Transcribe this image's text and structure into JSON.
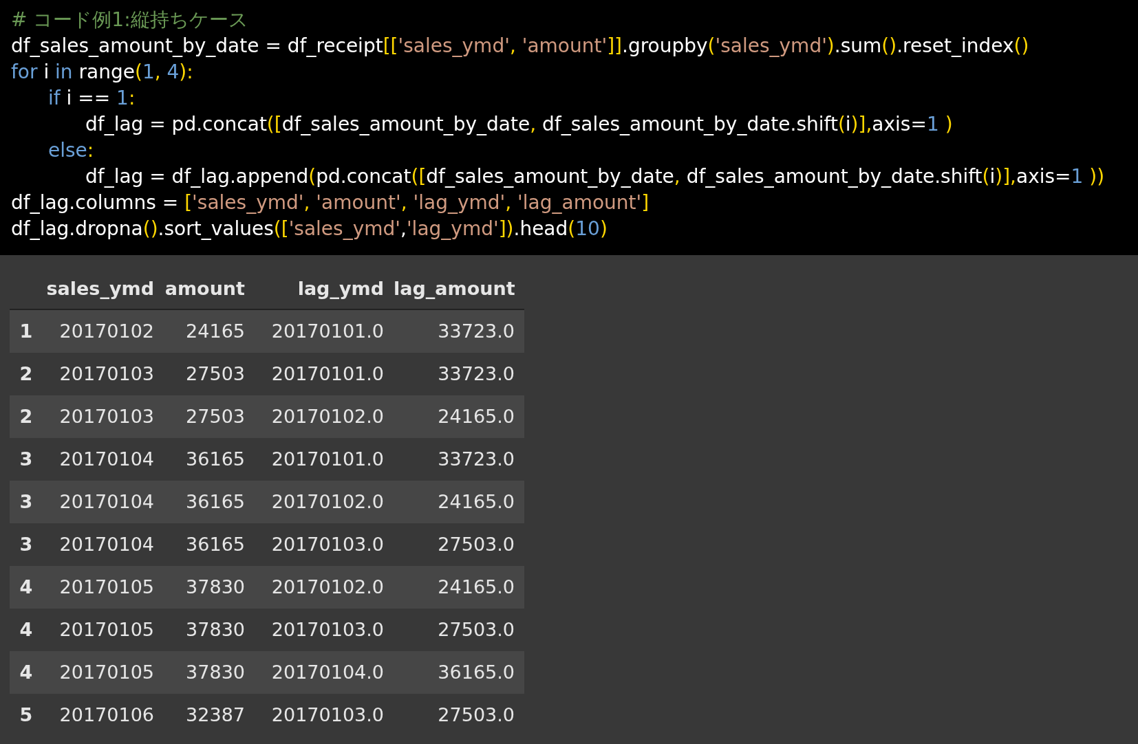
{
  "code": {
    "lines": [
      {
        "tokens": [
          {
            "kind": "comment",
            "text": "# コード例1:縦持ちケース"
          }
        ]
      },
      {
        "tokens": [
          {
            "kind": "text",
            "text": "df_sales_amount_by_date = df_receipt"
          },
          {
            "kind": "paren",
            "text": "[["
          },
          {
            "kind": "string",
            "text": "'sales_ymd'"
          },
          {
            "kind": "paren",
            "text": ", "
          },
          {
            "kind": "string",
            "text": "'amount'"
          },
          {
            "kind": "paren",
            "text": "]]"
          },
          {
            "kind": "text",
            "text": ".groupby"
          },
          {
            "kind": "paren",
            "text": "("
          },
          {
            "kind": "string",
            "text": "'sales_ymd'"
          },
          {
            "kind": "paren",
            "text": ")"
          },
          {
            "kind": "text",
            "text": ".sum"
          },
          {
            "kind": "paren",
            "text": "()"
          },
          {
            "kind": "text",
            "text": ".reset_index"
          },
          {
            "kind": "paren",
            "text": "()"
          }
        ]
      },
      {
        "tokens": [
          {
            "kind": "keyword",
            "text": "for"
          },
          {
            "kind": "text",
            "text": " i "
          },
          {
            "kind": "keyword",
            "text": "in"
          },
          {
            "kind": "text",
            "text": " range"
          },
          {
            "kind": "paren",
            "text": "("
          },
          {
            "kind": "number",
            "text": "1"
          },
          {
            "kind": "paren",
            "text": ", "
          },
          {
            "kind": "number",
            "text": "4"
          },
          {
            "kind": "paren",
            "text": "):"
          }
        ],
        "children": [
          {
            "tokens": [
              {
                "kind": "keyword",
                "text": "if"
              },
              {
                "kind": "text",
                "text": " i == "
              },
              {
                "kind": "number",
                "text": "1"
              },
              {
                "kind": "paren",
                "text": ":"
              }
            ],
            "children": [
              {
                "tokens": [
                  {
                    "kind": "text",
                    "text": "df_lag = pd.concat"
                  },
                  {
                    "kind": "paren",
                    "text": "(["
                  },
                  {
                    "kind": "text",
                    "text": "df_sales_amount_by_date"
                  },
                  {
                    "kind": "paren",
                    "text": ", "
                  },
                  {
                    "kind": "text",
                    "text": "df_sales_amount_by_date.shift"
                  },
                  {
                    "kind": "paren",
                    "text": "("
                  },
                  {
                    "kind": "text",
                    "text": "i"
                  },
                  {
                    "kind": "paren",
                    "text": ")],"
                  },
                  {
                    "kind": "text",
                    "text": "axis="
                  },
                  {
                    "kind": "number",
                    "text": "1"
                  },
                  {
                    "kind": "paren",
                    "text": " )"
                  }
                ]
              }
            ]
          },
          {
            "tokens": [
              {
                "kind": "keyword",
                "text": "else"
              },
              {
                "kind": "paren",
                "text": ":"
              }
            ],
            "children": [
              {
                "tokens": [
                  {
                    "kind": "text",
                    "text": "df_lag = df_lag.append"
                  },
                  {
                    "kind": "paren",
                    "text": "("
                  },
                  {
                    "kind": "text",
                    "text": "pd.concat"
                  },
                  {
                    "kind": "paren",
                    "text": "(["
                  },
                  {
                    "kind": "text",
                    "text": "df_sales_amount_by_date"
                  },
                  {
                    "kind": "paren",
                    "text": ", "
                  },
                  {
                    "kind": "text",
                    "text": "df_sales_amount_by_date.shift"
                  },
                  {
                    "kind": "paren",
                    "text": "("
                  },
                  {
                    "kind": "text",
                    "text": "i"
                  },
                  {
                    "kind": "paren",
                    "text": ")],"
                  },
                  {
                    "kind": "text",
                    "text": "axis="
                  },
                  {
                    "kind": "number",
                    "text": "1"
                  },
                  {
                    "kind": "paren",
                    "text": " ))"
                  }
                ]
              }
            ]
          }
        ]
      },
      {
        "tokens": [
          {
            "kind": "text",
            "text": "df_lag.columns = "
          },
          {
            "kind": "paren",
            "text": "["
          },
          {
            "kind": "string",
            "text": "'sales_ymd'"
          },
          {
            "kind": "paren",
            "text": ", "
          },
          {
            "kind": "string",
            "text": "'amount'"
          },
          {
            "kind": "paren",
            "text": ", "
          },
          {
            "kind": "string",
            "text": "'lag_ymd'"
          },
          {
            "kind": "paren",
            "text": ", "
          },
          {
            "kind": "string",
            "text": "'lag_amount'"
          },
          {
            "kind": "paren",
            "text": "]"
          }
        ]
      },
      {
        "tokens": [
          {
            "kind": "text",
            "text": "df_lag.dropna"
          },
          {
            "kind": "paren",
            "text": "()"
          },
          {
            "kind": "text",
            "text": ".sort_values"
          },
          {
            "kind": "paren",
            "text": "(["
          },
          {
            "kind": "string",
            "text": "'sales_ymd'"
          },
          {
            "kind": "text",
            "text": ","
          },
          {
            "kind": "string",
            "text": "'lag_ymd'"
          },
          {
            "kind": "paren",
            "text": "])"
          },
          {
            "kind": "text",
            "text": ".head"
          },
          {
            "kind": "paren",
            "text": "("
          },
          {
            "kind": "number",
            "text": "10"
          },
          {
            "kind": "paren",
            "text": ")"
          }
        ]
      }
    ]
  },
  "table": {
    "columns": [
      "sales_ymd",
      "amount",
      "lag_ymd",
      "lag_amount"
    ],
    "rows": [
      {
        "index": "1",
        "cells": [
          "20170102",
          "24165",
          "20170101.0",
          "33723.0"
        ]
      },
      {
        "index": "2",
        "cells": [
          "20170103",
          "27503",
          "20170101.0",
          "33723.0"
        ]
      },
      {
        "index": "2",
        "cells": [
          "20170103",
          "27503",
          "20170102.0",
          "24165.0"
        ]
      },
      {
        "index": "3",
        "cells": [
          "20170104",
          "36165",
          "20170101.0",
          "33723.0"
        ]
      },
      {
        "index": "3",
        "cells": [
          "20170104",
          "36165",
          "20170102.0",
          "24165.0"
        ]
      },
      {
        "index": "3",
        "cells": [
          "20170104",
          "36165",
          "20170103.0",
          "27503.0"
        ]
      },
      {
        "index": "4",
        "cells": [
          "20170105",
          "37830",
          "20170102.0",
          "24165.0"
        ]
      },
      {
        "index": "4",
        "cells": [
          "20170105",
          "37830",
          "20170103.0",
          "27503.0"
        ]
      },
      {
        "index": "4",
        "cells": [
          "20170105",
          "37830",
          "20170104.0",
          "36165.0"
        ]
      },
      {
        "index": "5",
        "cells": [
          "20170106",
          "32387",
          "20170103.0",
          "27503.0"
        ]
      }
    ]
  }
}
